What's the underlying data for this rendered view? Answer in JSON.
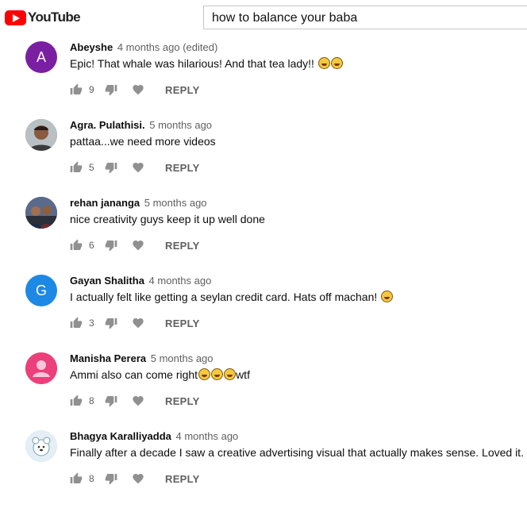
{
  "header": {
    "logo_text": "YouTube",
    "search_value": "how to balance your baba"
  },
  "comments": [
    {
      "author": "Abeyshe",
      "time": "4 months ago (edited)",
      "text": "Epic! That whale was hilarious! And that tea lady!! ",
      "emoji_count": 2,
      "likes": "9",
      "reply": "REPLY",
      "avatar_letter": "A",
      "avatar_color": "#7b1fa2"
    },
    {
      "author": "Agra. Pulathisi.",
      "time": "5 months ago",
      "text": "pattaa...we need more videos",
      "emoji_count": 0,
      "likes": "5",
      "reply": "REPLY",
      "avatar_letter": "",
      "avatar_color": "#8a6a55"
    },
    {
      "author": "rehan jananga",
      "time": "5 months ago",
      "text": "nice creativity guys keep it up well done",
      "emoji_count": 0,
      "likes": "6",
      "reply": "REPLY",
      "avatar_letter": "",
      "avatar_color": "#4a4f6a"
    },
    {
      "author": "Gayan Shalitha",
      "time": "4 months ago",
      "text": "I actually felt like getting a seylan credit card. Hats off machan! ",
      "emoji_count": 1,
      "likes": "3",
      "reply": "REPLY",
      "avatar_letter": "G",
      "avatar_color": "#1e88e5"
    },
    {
      "author": "Manisha Perera",
      "time": "5 months ago",
      "text": "Ammi also can come right",
      "text_after": "wtf",
      "emoji_count": 3,
      "likes": "8",
      "reply": "REPLY",
      "avatar_letter": "",
      "avatar_color": "#ec407a"
    },
    {
      "author": "Bhagya Karalliyadda",
      "time": "4 months ago",
      "text": "Finally after a decade I saw a creative advertising visual that actually makes sense. Loved it.",
      "emoji_count": 0,
      "likes": "8",
      "reply": "REPLY",
      "avatar_letter": "",
      "avatar_color": "#cfe2ee"
    }
  ]
}
